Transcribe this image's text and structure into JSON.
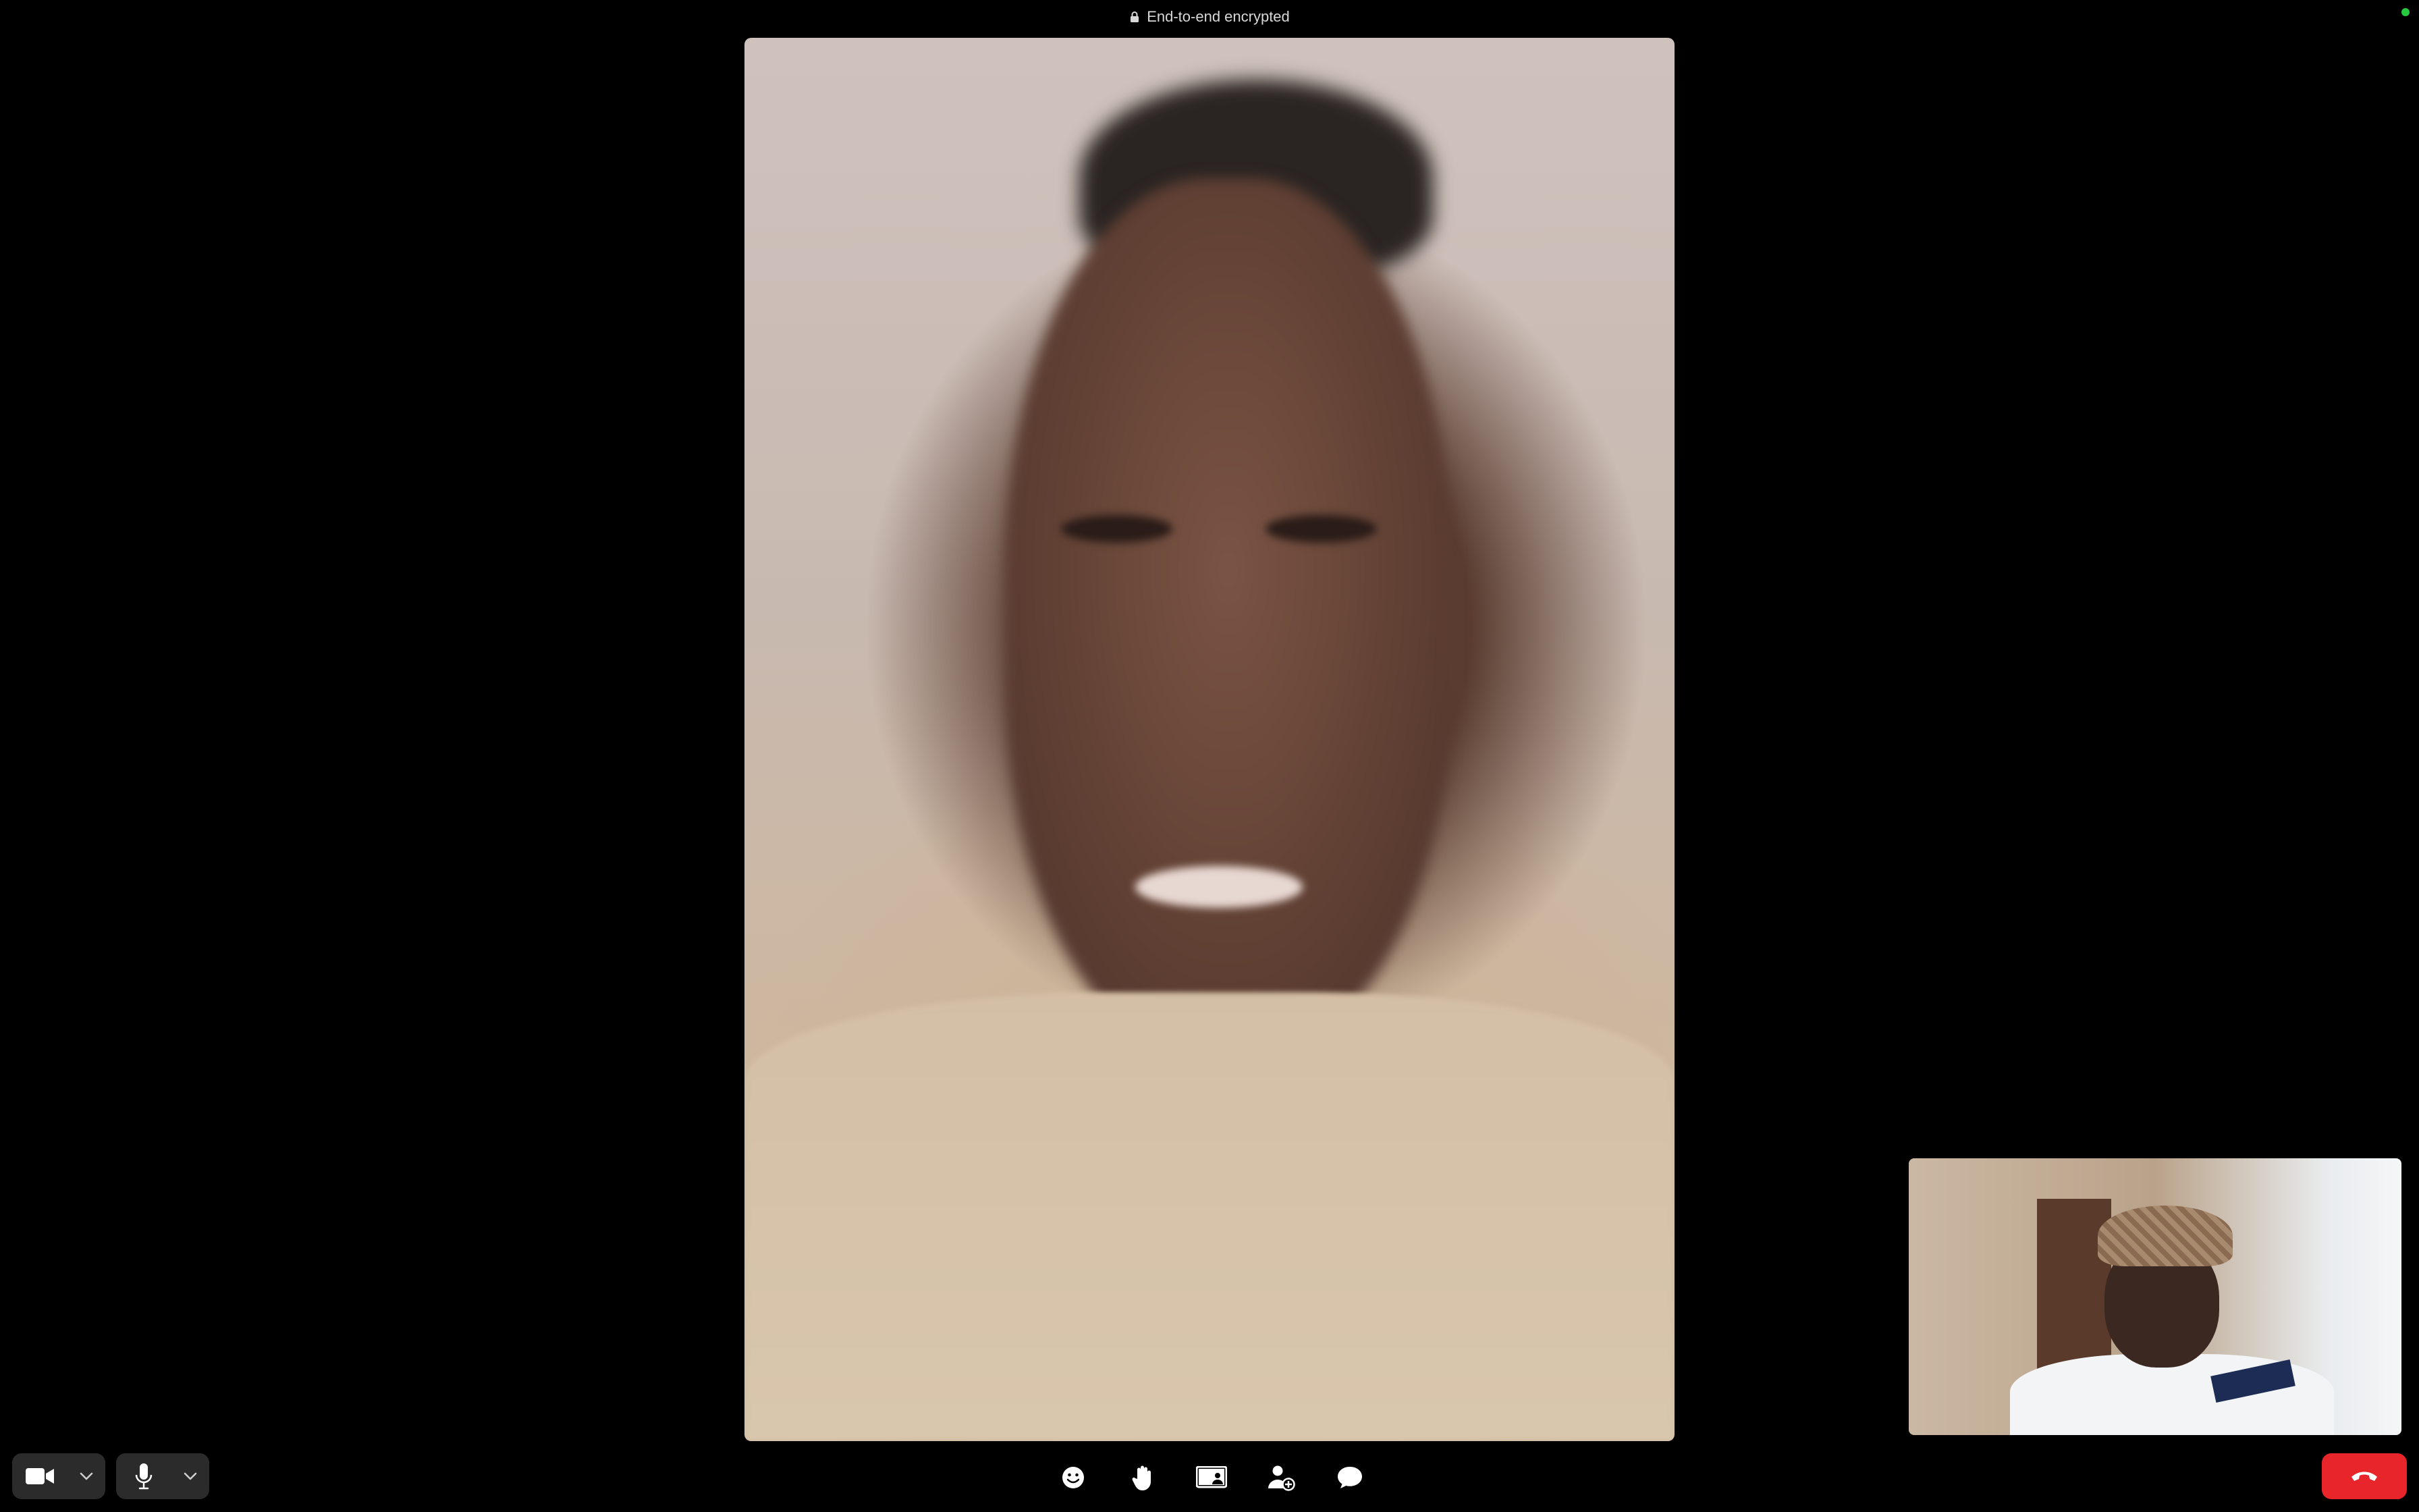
{
  "banner": {
    "text": "End-to-end encrypted",
    "icon": "lock-icon",
    "status_color": "#27c93f"
  },
  "remote_participant": {
    "video": "remote-video-feed"
  },
  "self_view": {
    "video": "self-video-feed"
  },
  "controls": {
    "left": [
      {
        "name": "camera-toggle",
        "icon": "video-camera-icon",
        "menu_icon": "chevron-down-icon"
      },
      {
        "name": "mic-toggle",
        "icon": "microphone-icon",
        "menu_icon": "chevron-down-icon"
      }
    ],
    "center": [
      {
        "name": "reactions-button",
        "icon": "smiley-icon"
      },
      {
        "name": "raise-hand-button",
        "icon": "hand-icon"
      },
      {
        "name": "share-screen-button",
        "icon": "screen-share-icon"
      },
      {
        "name": "add-participant-button",
        "icon": "add-person-icon"
      },
      {
        "name": "chat-button",
        "icon": "chat-bubble-icon"
      }
    ],
    "end_call": {
      "icon": "hang-up-icon",
      "color": "#e8252b"
    }
  }
}
